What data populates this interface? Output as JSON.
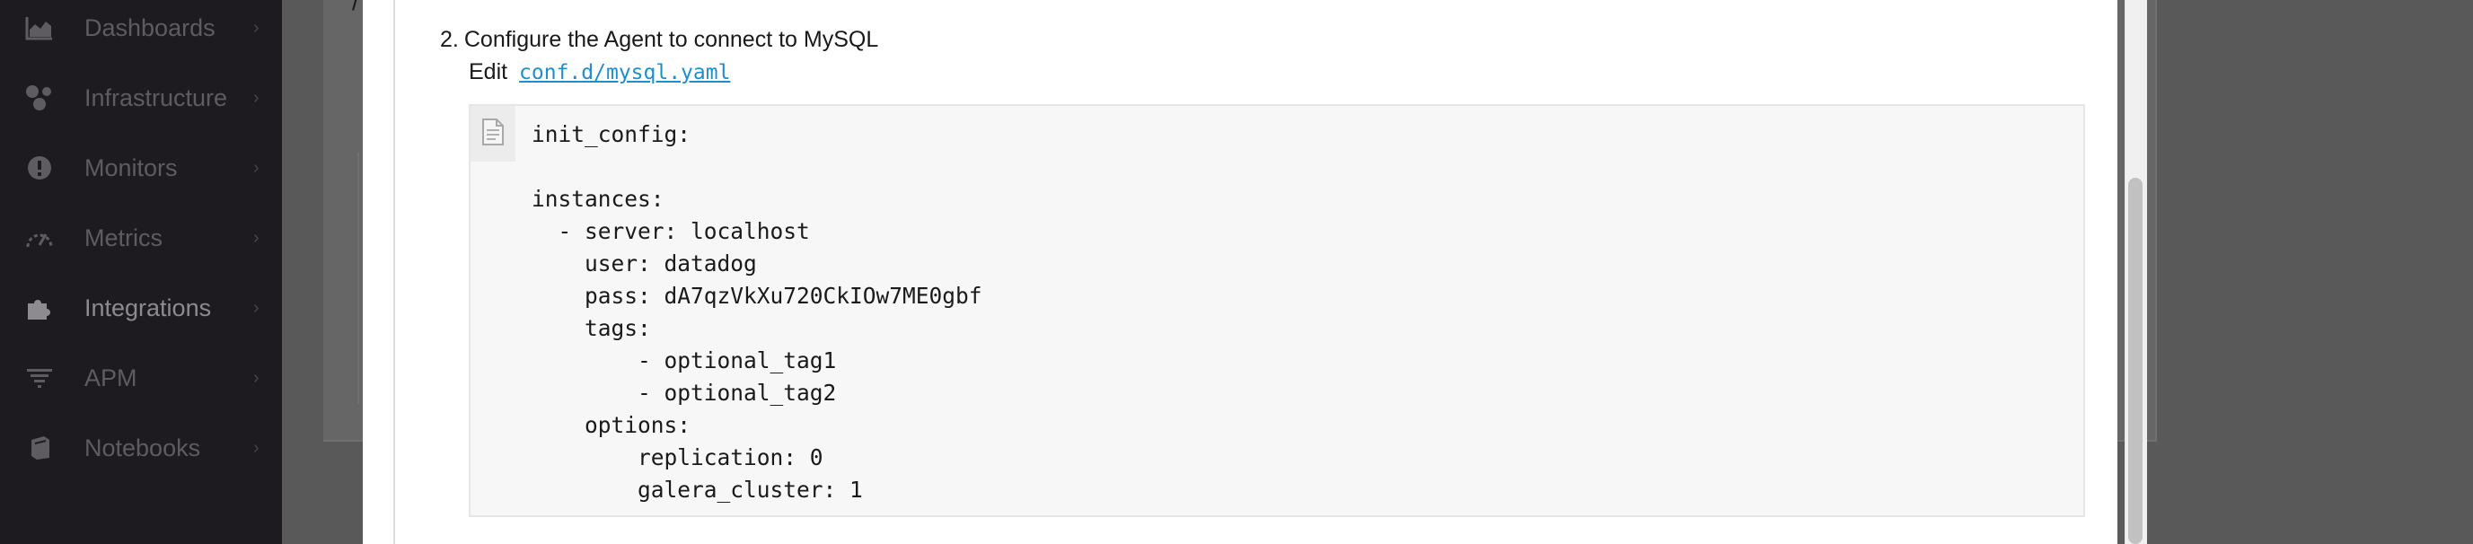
{
  "sidebar": {
    "items": [
      {
        "label": "Dashboards",
        "icon": "area-chart-icon"
      },
      {
        "label": "Infrastructure",
        "icon": "hexagon-nodes-icon"
      },
      {
        "label": "Monitors",
        "icon": "alert-circle-icon"
      },
      {
        "label": "Metrics",
        "icon": "gauge-icon"
      },
      {
        "label": "Integrations",
        "icon": "puzzle-piece-icon",
        "active": true
      },
      {
        "label": "APM",
        "icon": "filter-lines-icon"
      },
      {
        "label": "Notebooks",
        "icon": "notebook-icon"
      }
    ],
    "chevron": "›"
  },
  "background": {
    "fragment": "/"
  },
  "modal": {
    "step_number": "2.",
    "step_title": "Configure the Agent to connect to MySQL",
    "edit_prefix": "Edit",
    "edit_link": "conf.d/mysql.yaml",
    "code_icon": "file-icon",
    "code": "init_config:\n\ninstances:\n  - server: localhost\n    user: datadog\n    pass: dA7qzVkXu720CkIOw7ME0gbf\n    tags:\n        - optional_tag1\n        - optional_tag2\n    options:\n        replication: 0\n        galera_cluster: 1"
  },
  "colors": {
    "sidebar_bg": "#1d1b1f",
    "overlay_bg": "#595959",
    "link": "#1f8ecf",
    "code_bg": "#f7f7f7"
  }
}
